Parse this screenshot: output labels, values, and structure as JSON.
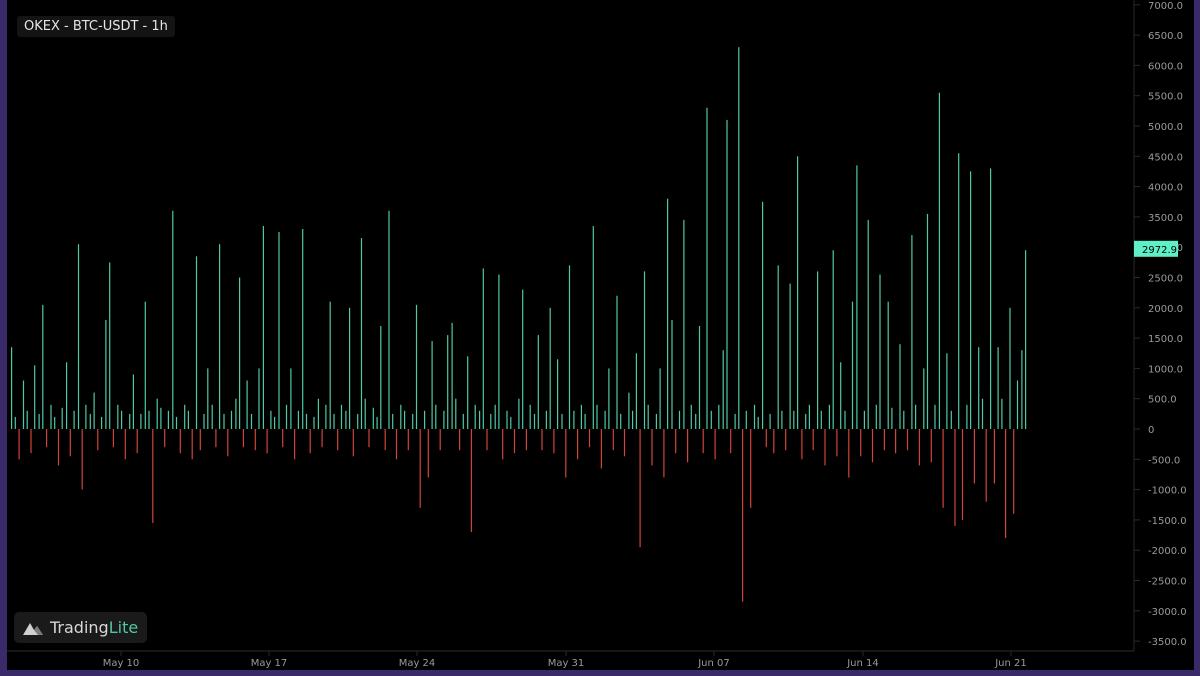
{
  "header": {
    "title": "OKEX - BTC-USDT - 1h"
  },
  "branding": {
    "name_part1": "Trading",
    "name_part2": "Lite",
    "icon": "tradinglite-logo-icon"
  },
  "colors": {
    "background": "#000000",
    "frame": "#3a2a6a",
    "positive": "#4fc8a5",
    "negative": "#d0453a",
    "axis_text": "#9a9a9a",
    "price_tag": "#5ff0c8"
  },
  "chart_data": {
    "type": "bar",
    "title": "OKEX - BTC-USDT - 1h",
    "xlabel": "",
    "ylabel": "",
    "ylim": [
      -3600,
      7000
    ],
    "yticks": [
      "7000.0",
      "6500.0",
      "6000.0",
      "5500.0",
      "5000.0",
      "4500.0",
      "4000.0",
      "3500.0",
      "3000.0",
      "2500.0",
      "2000.0",
      "1500.0",
      "1000.0",
      "500.0",
      "0",
      "-500.0",
      "-1000.0",
      "-1500.0",
      "-2000.0",
      "-2500.0",
      "-3000.0",
      "-3500.0"
    ],
    "xticks": [
      "May 10",
      "May 17",
      "May 24",
      "May 31",
      "Jun 07",
      "Jun 14",
      "Jun 21"
    ],
    "last_value_label": "2972.9",
    "grid": false,
    "series": [
      {
        "values": [
          [
            0.0,
            1350
          ],
          [
            0.6,
            200
          ],
          [
            1.2,
            -500
          ],
          [
            1.9,
            800
          ],
          [
            2.5,
            300
          ],
          [
            3.1,
            -400
          ],
          [
            3.7,
            1050
          ],
          [
            4.4,
            250
          ],
          [
            5.0,
            2050
          ],
          [
            5.6,
            -300
          ],
          [
            6.3,
            400
          ],
          [
            6.9,
            200
          ],
          [
            7.5,
            -600
          ],
          [
            8.1,
            350
          ],
          [
            8.8,
            1100
          ],
          [
            9.4,
            -450
          ],
          [
            10.0,
            300
          ],
          [
            10.7,
            3050
          ],
          [
            11.3,
            -1000
          ],
          [
            11.9,
            400
          ],
          [
            12.6,
            250
          ],
          [
            13.2,
            600
          ],
          [
            13.8,
            -350
          ],
          [
            14.4,
            200
          ],
          [
            15.1,
            1800
          ],
          [
            15.7,
            2750
          ],
          [
            16.3,
            -300
          ],
          [
            17.0,
            400
          ],
          [
            17.6,
            300
          ],
          [
            18.2,
            -500
          ],
          [
            18.9,
            250
          ],
          [
            19.5,
            900
          ],
          [
            20.1,
            -400
          ],
          [
            20.7,
            250
          ],
          [
            21.4,
            2100
          ],
          [
            22.0,
            300
          ],
          [
            22.6,
            -1550
          ],
          [
            23.3,
            500
          ],
          [
            23.9,
            350
          ],
          [
            24.5,
            -300
          ],
          [
            25.1,
            300
          ],
          [
            25.8,
            3600
          ],
          [
            26.4,
            200
          ],
          [
            27.0,
            -400
          ],
          [
            27.7,
            400
          ],
          [
            28.3,
            300
          ],
          [
            28.9,
            -500
          ],
          [
            29.6,
            2850
          ],
          [
            30.2,
            -350
          ],
          [
            30.8,
            250
          ],
          [
            31.4,
            1000
          ],
          [
            32.1,
            400
          ],
          [
            32.7,
            -300
          ],
          [
            33.3,
            3050
          ],
          [
            34.0,
            250
          ],
          [
            34.6,
            -450
          ],
          [
            35.2,
            300
          ],
          [
            35.9,
            500
          ],
          [
            36.5,
            2500
          ],
          [
            37.1,
            -300
          ],
          [
            37.7,
            800
          ],
          [
            38.4,
            250
          ],
          [
            39.0,
            -350
          ],
          [
            39.6,
            1000
          ],
          [
            40.3,
            3350
          ],
          [
            40.9,
            -400
          ],
          [
            41.5,
            300
          ],
          [
            42.1,
            200
          ],
          [
            42.8,
            3250
          ],
          [
            43.4,
            -300
          ],
          [
            44.0,
            400
          ],
          [
            44.7,
            1000
          ],
          [
            45.3,
            -500
          ],
          [
            45.9,
            300
          ],
          [
            46.6,
            3300
          ],
          [
            47.2,
            250
          ],
          [
            47.8,
            -400
          ],
          [
            48.4,
            200
          ],
          [
            49.1,
            500
          ],
          [
            49.7,
            -300
          ],
          [
            50.3,
            400
          ],
          [
            51.0,
            2100
          ],
          [
            51.6,
            250
          ],
          [
            52.2,
            -350
          ],
          [
            52.8,
            400
          ],
          [
            53.5,
            300
          ],
          [
            54.1,
            2000
          ],
          [
            54.7,
            -450
          ],
          [
            55.4,
            250
          ],
          [
            56.0,
            3150
          ],
          [
            56.6,
            500
          ],
          [
            57.2,
            -300
          ],
          [
            57.9,
            350
          ],
          [
            58.5,
            200
          ],
          [
            59.1,
            1700
          ],
          [
            59.8,
            -350
          ],
          [
            60.4,
            3600
          ],
          [
            61.0,
            250
          ],
          [
            61.6,
            -500
          ],
          [
            62.3,
            400
          ],
          [
            62.9,
            300
          ],
          [
            63.5,
            -350
          ],
          [
            64.2,
            250
          ],
          [
            64.8,
            2050
          ],
          [
            65.4,
            -1300
          ],
          [
            66.1,
            300
          ],
          [
            66.7,
            -800
          ],
          [
            67.3,
            1450
          ],
          [
            67.9,
            400
          ],
          [
            68.6,
            -350
          ],
          [
            69.2,
            300
          ],
          [
            69.8,
            1550
          ],
          [
            70.5,
            1750
          ],
          [
            71.1,
            500
          ],
          [
            71.7,
            -350
          ],
          [
            72.3,
            250
          ],
          [
            73.0,
            1200
          ],
          [
            73.6,
            -1700
          ],
          [
            74.2,
            400
          ],
          [
            74.9,
            300
          ],
          [
            75.5,
            2650
          ],
          [
            76.1,
            -350
          ],
          [
            76.7,
            250
          ],
          [
            77.4,
            400
          ],
          [
            78.0,
            2550
          ],
          [
            78.6,
            -500
          ],
          [
            79.3,
            300
          ],
          [
            79.9,
            200
          ],
          [
            80.5,
            -400
          ],
          [
            81.2,
            500
          ],
          [
            81.8,
            2300
          ],
          [
            82.4,
            -350
          ],
          [
            83.0,
            400
          ],
          [
            83.7,
            250
          ],
          [
            84.3,
            1550
          ],
          [
            84.9,
            -350
          ],
          [
            85.6,
            300
          ],
          [
            86.2,
            2000
          ],
          [
            86.8,
            -400
          ],
          [
            87.4,
            1150
          ],
          [
            88.1,
            250
          ],
          [
            88.7,
            -800
          ],
          [
            89.3,
            2700
          ],
          [
            90.0,
            300
          ],
          [
            90.6,
            -500
          ],
          [
            91.2,
            400
          ],
          [
            91.8,
            250
          ],
          [
            92.5,
            -300
          ],
          [
            93.1,
            3350
          ],
          [
            93.7,
            400
          ],
          [
            94.4,
            -650
          ],
          [
            95.0,
            300
          ],
          [
            95.6,
            1000
          ],
          [
            96.3,
            -350
          ],
          [
            96.9,
            2200
          ],
          [
            97.5,
            250
          ],
          [
            98.1,
            -450
          ],
          [
            98.8,
            600
          ],
          [
            99.4,
            300
          ],
          [
            100.0,
            1250
          ],
          [
            100.6,
            -1950
          ],
          [
            101.3,
            2600
          ],
          [
            101.9,
            400
          ],
          [
            102.5,
            -600
          ],
          [
            103.2,
            250
          ],
          [
            103.8,
            1000
          ],
          [
            104.4,
            -800
          ],
          [
            105.0,
            3800
          ],
          [
            105.7,
            1800
          ],
          [
            106.3,
            -400
          ],
          [
            106.9,
            300
          ],
          [
            107.6,
            3450
          ],
          [
            108.2,
            -550
          ],
          [
            108.8,
            400
          ],
          [
            109.5,
            250
          ],
          [
            110.1,
            1700
          ],
          [
            110.7,
            -400
          ],
          [
            111.3,
            5300
          ],
          [
            112.0,
            300
          ],
          [
            112.6,
            -500
          ],
          [
            113.2,
            400
          ],
          [
            113.9,
            1300
          ],
          [
            114.5,
            5100
          ],
          [
            115.1,
            -400
          ],
          [
            115.8,
            250
          ],
          [
            116.4,
            6300
          ],
          [
            117.0,
            -2850
          ],
          [
            117.6,
            300
          ],
          [
            118.3,
            -1300
          ],
          [
            118.9,
            400
          ],
          [
            119.5,
            200
          ],
          [
            120.2,
            3750
          ],
          [
            120.8,
            -300
          ],
          [
            121.4,
            250
          ],
          [
            122.0,
            -400
          ],
          [
            122.7,
            2700
          ],
          [
            123.3,
            300
          ],
          [
            123.9,
            -350
          ],
          [
            124.6,
            2400
          ],
          [
            125.2,
            300
          ],
          [
            125.8,
            4500
          ],
          [
            126.5,
            -500
          ],
          [
            127.1,
            250
          ],
          [
            127.7,
            400
          ],
          [
            128.3,
            -350
          ],
          [
            129.0,
            2600
          ],
          [
            129.6,
            300
          ],
          [
            130.2,
            -600
          ],
          [
            130.9,
            400
          ],
          [
            131.5,
            2950
          ],
          [
            132.1,
            -450
          ],
          [
            132.7,
            1100
          ],
          [
            133.4,
            300
          ],
          [
            134.0,
            -800
          ],
          [
            134.6,
            2100
          ],
          [
            135.3,
            4350
          ],
          [
            135.9,
            -450
          ],
          [
            136.5,
            300
          ],
          [
            137.1,
            3450
          ],
          [
            137.8,
            -550
          ],
          [
            138.4,
            400
          ],
          [
            139.0,
            2550
          ],
          [
            139.7,
            -350
          ],
          [
            140.3,
            2100
          ],
          [
            140.9,
            350
          ],
          [
            141.5,
            -400
          ],
          [
            142.2,
            1400
          ],
          [
            142.8,
            300
          ],
          [
            143.4,
            -350
          ],
          [
            144.1,
            3200
          ],
          [
            144.7,
            400
          ],
          [
            145.3,
            -600
          ],
          [
            146.0,
            1000
          ],
          [
            146.6,
            3550
          ],
          [
            147.2,
            -550
          ],
          [
            147.8,
            400
          ],
          [
            148.5,
            5550
          ],
          [
            149.1,
            -1300
          ],
          [
            149.7,
            1250
          ],
          [
            150.4,
            300
          ],
          [
            151.0,
            -1600
          ],
          [
            151.6,
            4550
          ],
          [
            152.2,
            -1500
          ],
          [
            152.9,
            400
          ],
          [
            153.5,
            4250
          ],
          [
            154.1,
            -900
          ],
          [
            154.8,
            1350
          ],
          [
            155.4,
            500
          ],
          [
            156.0,
            -1200
          ],
          [
            156.7,
            4300
          ],
          [
            157.3,
            -900
          ],
          [
            157.9,
            1350
          ],
          [
            158.5,
            500
          ],
          [
            159.1,
            -1800
          ],
          [
            159.8,
            2000
          ],
          [
            160.4,
            -1400
          ],
          [
            161.0,
            800
          ],
          [
            161.7,
            1300
          ],
          [
            162.3,
            2950
          ]
        ]
      }
    ]
  }
}
